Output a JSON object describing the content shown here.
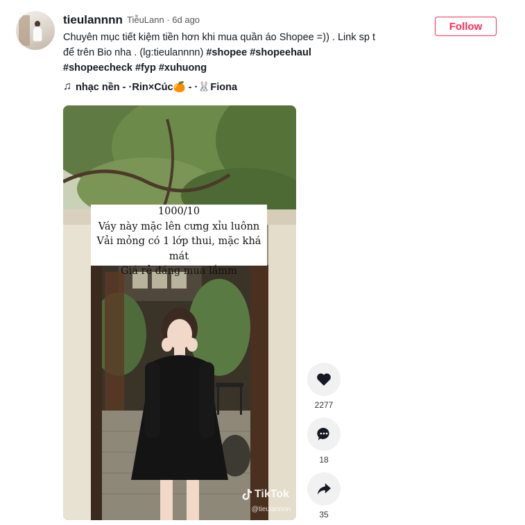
{
  "post": {
    "username": "tieulannnn",
    "nickname_time": "TiễuLann · 6d ago",
    "caption_text": "Chuyên mục tiết kiệm tiền hơn khi mua quần áo Shopee =)) . Link sp t để trên Bio nha . (lg:tieulannnn) ",
    "hashtags": [
      "#shopee",
      "#shopeehaul",
      "#shopeecheck",
      "#fyp",
      "#xuhuong"
    ],
    "music": "nhạc nền - ·Rin×Cúc🍊 - ·🐰Fiona",
    "follow_label": "Follow"
  },
  "video": {
    "overlay_lines": [
      "1000/10",
      "Váy này mặc lên cưng xỉu luônn",
      "Vải mỏng có 1 lớp thui, mặc khá mát",
      "Giá rẻ đáng mua lắmm"
    ],
    "watermark": "TikTok",
    "watermark_user": "@tieulannnn"
  },
  "actions": {
    "likes": "2277",
    "comments": "18",
    "shares": "35"
  },
  "icons": [
    "music-note-icon",
    "heart-icon",
    "comment-icon",
    "share-icon",
    "tiktok-logo-icon"
  ]
}
